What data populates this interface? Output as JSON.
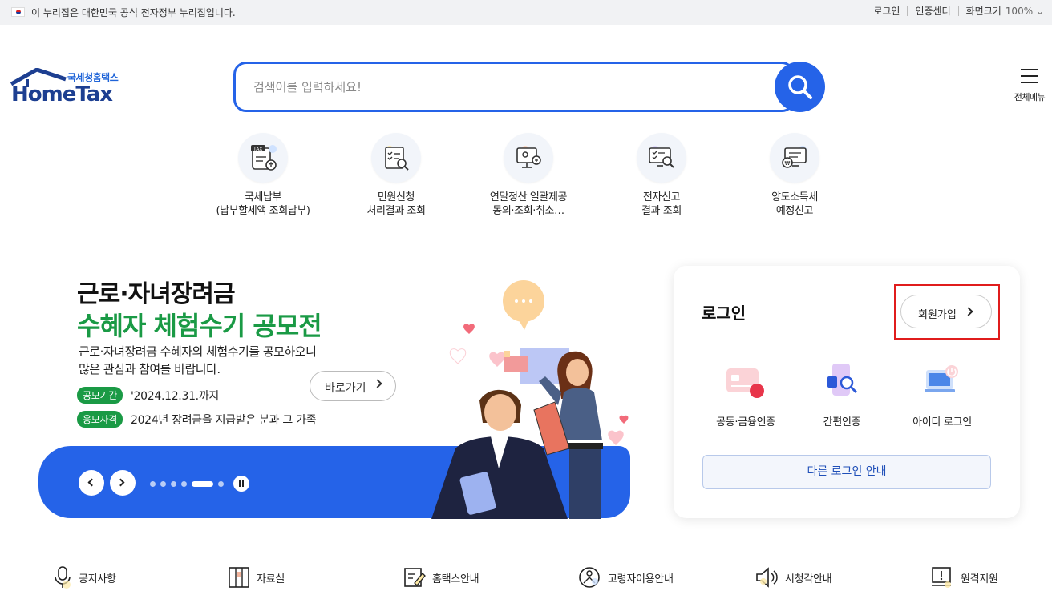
{
  "gov_bar": {
    "notice": "이 누리집은 대한민국 공식 전자정부 누리집입니다.",
    "links": [
      "로그인",
      "인증센터",
      "화면크기"
    ],
    "zoom": "100%"
  },
  "logo": {
    "sub": "국세청홈택스",
    "main": "HomeTax"
  },
  "search": {
    "placeholder": "검색어를 입력하세요!"
  },
  "all_menu": {
    "label": "전체메뉴"
  },
  "quick_menu": [
    {
      "line1": "국세납부",
      "line2": "(납부할세액 조회납부)",
      "icon": "tax-payment-icon"
    },
    {
      "line1": "민원신청",
      "line2": "처리결과 조회",
      "icon": "civil-request-icon"
    },
    {
      "line1": "연말정산 일괄제공",
      "line2": "동의·조회·취소…",
      "icon": "year-end-settlement-icon"
    },
    {
      "line1": "전자신고",
      "line2": "결과 조회",
      "icon": "e-filing-result-icon"
    },
    {
      "line1": "양도소득세",
      "line2": "예정신고",
      "icon": "capital-gains-tax-icon"
    }
  ],
  "banner": {
    "title1": "근로·자녀장려금",
    "title2": "수혜자 체험수기 공모전",
    "desc1": "근로·자녀장려금 수혜자의 체험수기를 공모하오니",
    "desc2": "많은 관심과 참여를 바랍니다.",
    "period_tag": "공모기간",
    "period": "'2024.12.31.까지",
    "eligibility_tag": "응모자격",
    "eligibility": "2024년 장려금을 지급받은 분과 그 가족",
    "go_label": "바로가기",
    "slide_count": 6,
    "active_slide": 5,
    "colors": {
      "accent": "#2563e8",
      "green": "#1a9a45"
    }
  },
  "login": {
    "title": "로그인",
    "join_label": "회원가입",
    "options": [
      "공동·금융인증",
      "간편인증",
      "아이디 로그인"
    ],
    "other_label": "다른 로그인 안내"
  },
  "bottom_links": [
    {
      "label": "공지사항",
      "icon": "microphone-icon"
    },
    {
      "label": "자료실",
      "icon": "archive-icon"
    },
    {
      "label": "홈택스안내",
      "icon": "guide-icon"
    },
    {
      "label": "고령자이용안내",
      "icon": "senior-icon"
    },
    {
      "label": "시청각안내",
      "icon": "audio-visual-icon"
    },
    {
      "label": "원격지원",
      "icon": "remote-support-icon"
    }
  ]
}
